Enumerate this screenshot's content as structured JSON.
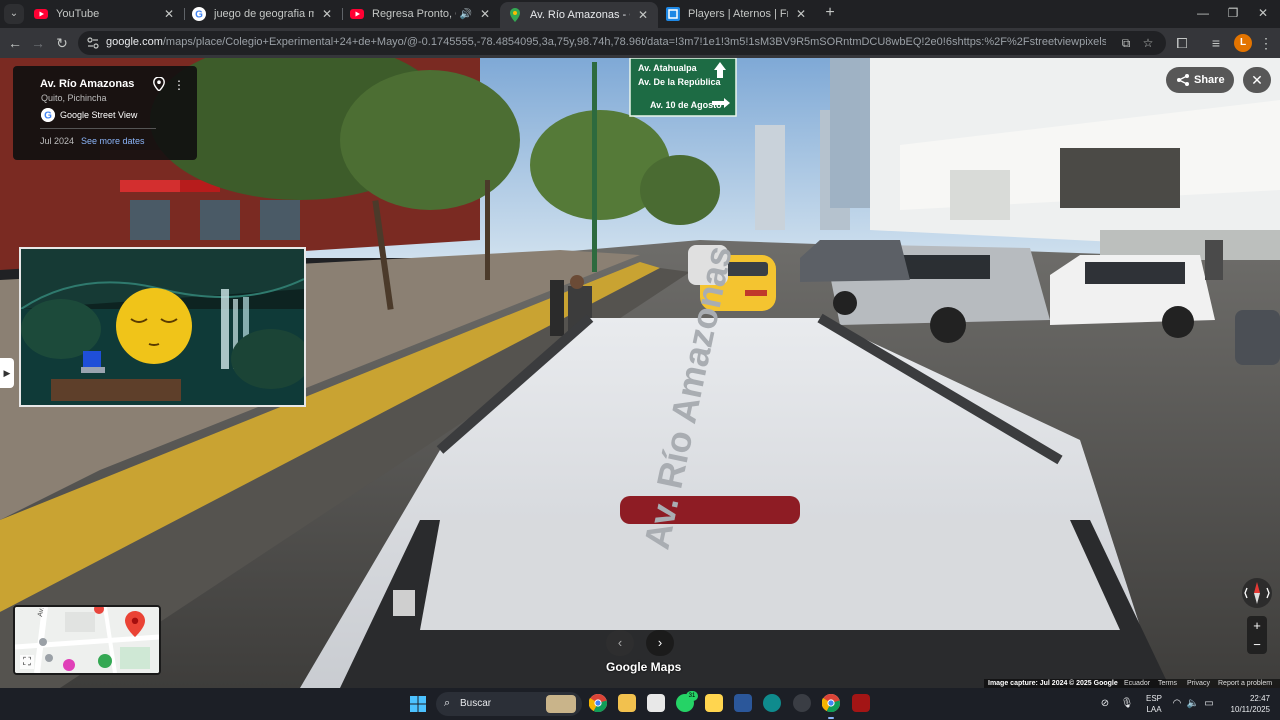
{
  "browser": {
    "tabs": [
      {
        "title": "YouTube",
        "icon": "youtube-icon",
        "active": false
      },
      {
        "title": "juego de geografia mapa strea",
        "icon": "google-icon",
        "active": false
      },
      {
        "title": "Regresa Pronto, Grupo Gala",
        "icon": "youtube-icon",
        "active": false
      },
      {
        "title": "Av. Río Amazonas - Google Ma",
        "icon": "maps-pin-icon",
        "active": true
      },
      {
        "title": "Players | Aternos | Free Minecra",
        "icon": "aternos-icon",
        "active": false
      }
    ],
    "url_host": "google.com",
    "url_path": "/maps/place/Colegio+Experimental+24+de+Mayo/@-0.1745555,-78.4854095,3a,75y,98.74h,78.96t/data=!3m7!1e1!3m5!1sM3BV9R5mSORntmDCU8wbEQ!2e0!6shttps:%2F%2Fstreetviewpixels-pa.googleapis.com%2Fv1%2Fthumbnai...",
    "profile_initial": "L",
    "colors": {
      "tab_bg": "#202124",
      "active_tab": "#35363a",
      "youtube_red": "#ff0033",
      "profile": "#e37400"
    }
  },
  "streetview": {
    "place_title": "Av. Río Amazonas",
    "place_subtitle": "Quito, Pichincha",
    "source_label": "Google Street View",
    "capture_date": "Jul 2024",
    "more_dates_link": "See more dates",
    "share_label": "Share",
    "close_icon": "close-icon",
    "logo_text": "Google Maps",
    "road_sign": {
      "line1": "Av. Atahualpa",
      "line2": "Av. De la República",
      "line3": "Av. 10 de Agosto"
    },
    "roof_text": "Av. Río Amazonas",
    "zoom_in": "+",
    "zoom_out": "−",
    "footer": {
      "capture": "Image capture: Jul 2024",
      "copyright": "© 2025 Google",
      "country": "Ecuador",
      "terms": "Terms",
      "privacy": "Privacy",
      "report": "Report a problem"
    },
    "minimap_street": "Av. de"
  },
  "taskbar": {
    "search_placeholder": "Buscar",
    "lang_line1": "ESP",
    "lang_line2": "LAA",
    "time": "22:47",
    "date": "10/11/2025",
    "whatsapp_badge": "31"
  }
}
